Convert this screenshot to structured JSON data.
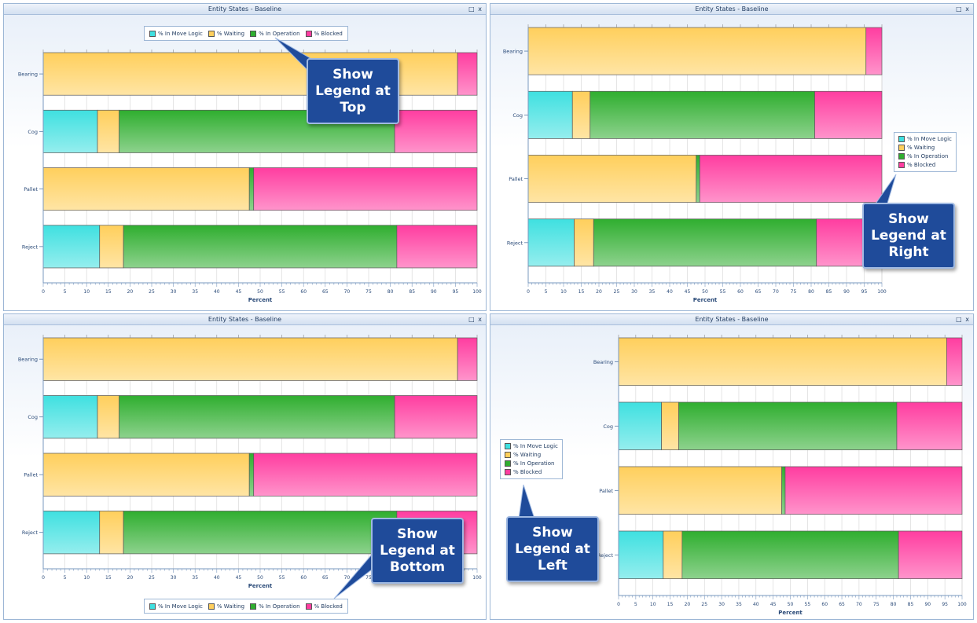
{
  "panel_title": "Entity States - Baseline",
  "window_controls": "□ x",
  "series_colors": {
    "% In Move Logic": "#3fe0e0",
    "% Waiting": "#ffcf5c",
    "% In Operation": "#2fae2f",
    "% Blocked": "#ff3da0"
  },
  "legend_labels": [
    "% In Move Logic",
    "% Waiting",
    "% In Operation",
    "% Blocked"
  ],
  "callouts": {
    "top": "Show\nLegend at\nTop",
    "right": "Show\nLegend at\nRight",
    "bottom": "Show\nLegend at\nBottom",
    "left": "Show\nLegend at\nLeft"
  },
  "chart_data": [
    {
      "type": "bar",
      "orientation": "horizontal",
      "stacked": true,
      "title": "Entity States - Baseline",
      "legend_position": "top",
      "xlabel": "Percent",
      "xlim": [
        0,
        100
      ],
      "xticks": [
        "0",
        "5",
        "10",
        "15",
        "20",
        "25",
        "30",
        "35",
        "40",
        "45",
        "50",
        "55",
        "60",
        "65",
        "70",
        "75",
        "80",
        "85",
        "90",
        "95",
        "100"
      ],
      "categories": [
        "Bearing",
        "Cog",
        "Pallet",
        "Reject"
      ],
      "series": [
        {
          "name": "% In Move Logic",
          "values": [
            0,
            12.5,
            0,
            13
          ]
        },
        {
          "name": "% Waiting",
          "values": [
            95.5,
            5,
            47.5,
            5.5
          ]
        },
        {
          "name": "% In Operation",
          "values": [
            0,
            63.5,
            1,
            63
          ]
        },
        {
          "name": "% Blocked",
          "values": [
            4.5,
            19,
            51.5,
            18.5
          ]
        }
      ]
    },
    {
      "type": "bar",
      "orientation": "horizontal",
      "stacked": true,
      "title": "Entity States - Baseline",
      "legend_position": "right",
      "xlabel": "Percent",
      "xlim": [
        0,
        100
      ],
      "xticks": [
        "0",
        "5",
        "10",
        "15",
        "20",
        "25",
        "30",
        "35",
        "40",
        "45",
        "50",
        "55",
        "60",
        "65",
        "70",
        "75",
        "80",
        "85",
        "90",
        "95",
        "100"
      ],
      "categories": [
        "Bearing",
        "Cog",
        "Pallet",
        "Reject"
      ],
      "series": [
        {
          "name": "% In Move Logic",
          "values": [
            0,
            12.5,
            0,
            13
          ]
        },
        {
          "name": "% Waiting",
          "values": [
            95.5,
            5,
            47.5,
            5.5
          ]
        },
        {
          "name": "% In Operation",
          "values": [
            0,
            63.5,
            1,
            63
          ]
        },
        {
          "name": "% Blocked",
          "values": [
            4.5,
            19,
            51.5,
            18.5
          ]
        }
      ]
    },
    {
      "type": "bar",
      "orientation": "horizontal",
      "stacked": true,
      "title": "Entity States - Baseline",
      "legend_position": "bottom",
      "xlabel": "Percent",
      "xlim": [
        0,
        100
      ],
      "xticks": [
        "0",
        "5",
        "10",
        "15",
        "20",
        "25",
        "30",
        "35",
        "40",
        "45",
        "50",
        "55",
        "60",
        "65",
        "70",
        "75",
        "80",
        "85",
        "90",
        "95",
        "100"
      ],
      "categories": [
        "Bearing",
        "Cog",
        "Pallet",
        "Reject"
      ],
      "series": [
        {
          "name": "% In Move Logic",
          "values": [
            0,
            12.5,
            0,
            13
          ]
        },
        {
          "name": "% Waiting",
          "values": [
            95.5,
            5,
            47.5,
            5.5
          ]
        },
        {
          "name": "% In Operation",
          "values": [
            0,
            63.5,
            1,
            63
          ]
        },
        {
          "name": "% Blocked",
          "values": [
            4.5,
            19,
            51.5,
            18.5
          ]
        }
      ]
    },
    {
      "type": "bar",
      "orientation": "horizontal",
      "stacked": true,
      "title": "Entity States - Baseline",
      "legend_position": "left",
      "xlabel": "Percent",
      "xlim": [
        0,
        100
      ],
      "xticks": [
        "0",
        "5",
        "10",
        "15",
        "20",
        "25",
        "30",
        "35",
        "40",
        "45",
        "50",
        "55",
        "60",
        "65",
        "70",
        "75",
        "80",
        "85",
        "90",
        "95",
        "100"
      ],
      "categories": [
        "Bearing",
        "Cog",
        "Pallet",
        "Reject"
      ],
      "series": [
        {
          "name": "% In Move Logic",
          "values": [
            0,
            12.5,
            0,
            13
          ]
        },
        {
          "name": "% Waiting",
          "values": [
            95.5,
            5,
            47.5,
            5.5
          ]
        },
        {
          "name": "% In Operation",
          "values": [
            0,
            63.5,
            1,
            63
          ]
        },
        {
          "name": "% Blocked",
          "values": [
            4.5,
            19,
            51.5,
            18.5
          ]
        }
      ]
    }
  ]
}
